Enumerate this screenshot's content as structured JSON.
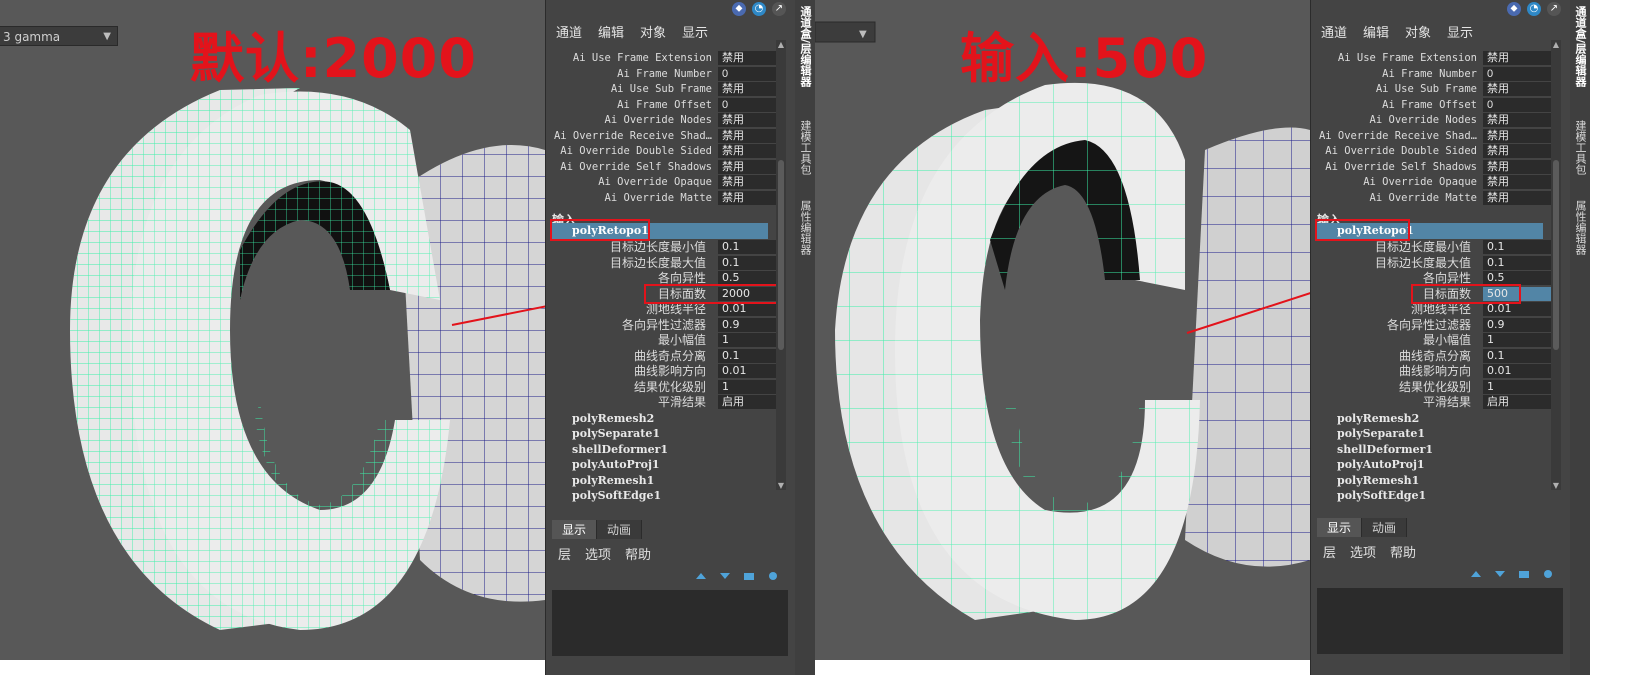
{
  "left": {
    "gamma_label": "3 gamma",
    "big_title": "默认:2000",
    "editor": {
      "menu": [
        "通道",
        "编辑",
        "对象",
        "显示"
      ],
      "attrs": [
        {
          "label": "Ai Use Frame Extension",
          "value": "禁用"
        },
        {
          "label": "Ai Frame Number",
          "value": "0"
        },
        {
          "label": "Ai Use Sub Frame",
          "value": "禁用"
        },
        {
          "label": "Ai Frame Offset",
          "value": "0"
        },
        {
          "label": "Ai Override Nodes",
          "value": "禁用"
        },
        {
          "label": "Ai Override Receive Shad…",
          "value": "禁用"
        },
        {
          "label": "Ai Override Double Sided",
          "value": "禁用"
        },
        {
          "label": "Ai Override Self Shadows",
          "value": "禁用"
        },
        {
          "label": "Ai Override Opaque",
          "value": "禁用"
        },
        {
          "label": "Ai Override Matte",
          "value": "禁用"
        }
      ],
      "input_label": "输入",
      "node_selected": "polyRetopo1",
      "params": [
        {
          "label": "目标边长度最小值",
          "value": "0.1"
        },
        {
          "label": "目标边长度最大值",
          "value": "0.1"
        },
        {
          "label": "各向异性",
          "value": "0.5"
        },
        {
          "label": "目标面数",
          "value": "2000"
        },
        {
          "label": "测地线半径",
          "value": "0.01"
        },
        {
          "label": "各向异性过滤器",
          "value": "0.9"
        },
        {
          "label": "最小幅值",
          "value": "1"
        },
        {
          "label": "曲线奇点分离",
          "value": "0.1"
        },
        {
          "label": "曲线影响方向",
          "value": "0.01"
        },
        {
          "label": "结果优化级别",
          "value": "1"
        },
        {
          "label": "平滑结果",
          "value": "启用"
        }
      ],
      "nodes": [
        "polyRemesh2",
        "polySeparate1",
        "shellDeformer1",
        "polyAutoProj1",
        "polyRemesh1",
        "polySoftEdge1"
      ],
      "layer_tabs": [
        "显示",
        "动画"
      ],
      "layer_menu": [
        "层",
        "选项",
        "帮助"
      ],
      "side_tabs": [
        "通道盒/层编辑器",
        "建模工具包",
        "属性编辑器"
      ]
    }
  },
  "right": {
    "big_title": "输入:500",
    "editor": {
      "menu": [
        "通道",
        "编辑",
        "对象",
        "显示"
      ],
      "attrs": [
        {
          "label": "Ai Use Frame Extension",
          "value": "禁用"
        },
        {
          "label": "Ai Frame Number",
          "value": "0"
        },
        {
          "label": "Ai Use Sub Frame",
          "value": "禁用"
        },
        {
          "label": "Ai Frame Offset",
          "value": "0"
        },
        {
          "label": "Ai Override Nodes",
          "value": "禁用"
        },
        {
          "label": "Ai Override Receive Shad…",
          "value": "禁用"
        },
        {
          "label": "Ai Override Double Sided",
          "value": "禁用"
        },
        {
          "label": "Ai Override Self Shadows",
          "value": "禁用"
        },
        {
          "label": "Ai Override Opaque",
          "value": "禁用"
        },
        {
          "label": "Ai Override Matte",
          "value": "禁用"
        }
      ],
      "input_label": "输入",
      "node_selected": "polyRetopo1",
      "params": [
        {
          "label": "目标边长度最小值",
          "value": "0.1"
        },
        {
          "label": "目标边长度最大值",
          "value": "0.1"
        },
        {
          "label": "各向异性",
          "value": "0.5"
        },
        {
          "label": "目标面数",
          "value": "500"
        },
        {
          "label": "测地线半径",
          "value": "0.01"
        },
        {
          "label": "各向异性过滤器",
          "value": "0.9"
        },
        {
          "label": "最小幅值",
          "value": "1"
        },
        {
          "label": "曲线奇点分离",
          "value": "0.1"
        },
        {
          "label": "曲线影响方向",
          "value": "0.01"
        },
        {
          "label": "结果优化级别",
          "value": "1"
        },
        {
          "label": "平滑结果",
          "value": "启用"
        }
      ],
      "nodes": [
        "polyRemesh2",
        "polySeparate1",
        "shellDeformer1",
        "polyAutoProj1",
        "polyRemesh1",
        "polySoftEdge1"
      ],
      "layer_tabs": [
        "显示",
        "动画"
      ],
      "layer_menu": [
        "层",
        "选项",
        "帮助"
      ],
      "side_tabs": [
        "通道盒/层编辑器",
        "建模工具包",
        "属性编辑器"
      ]
    }
  },
  "colors": {
    "annotation_red": "#e3131b",
    "wire_green": "#3cf0a8",
    "selection_blue": "#5285a6"
  }
}
